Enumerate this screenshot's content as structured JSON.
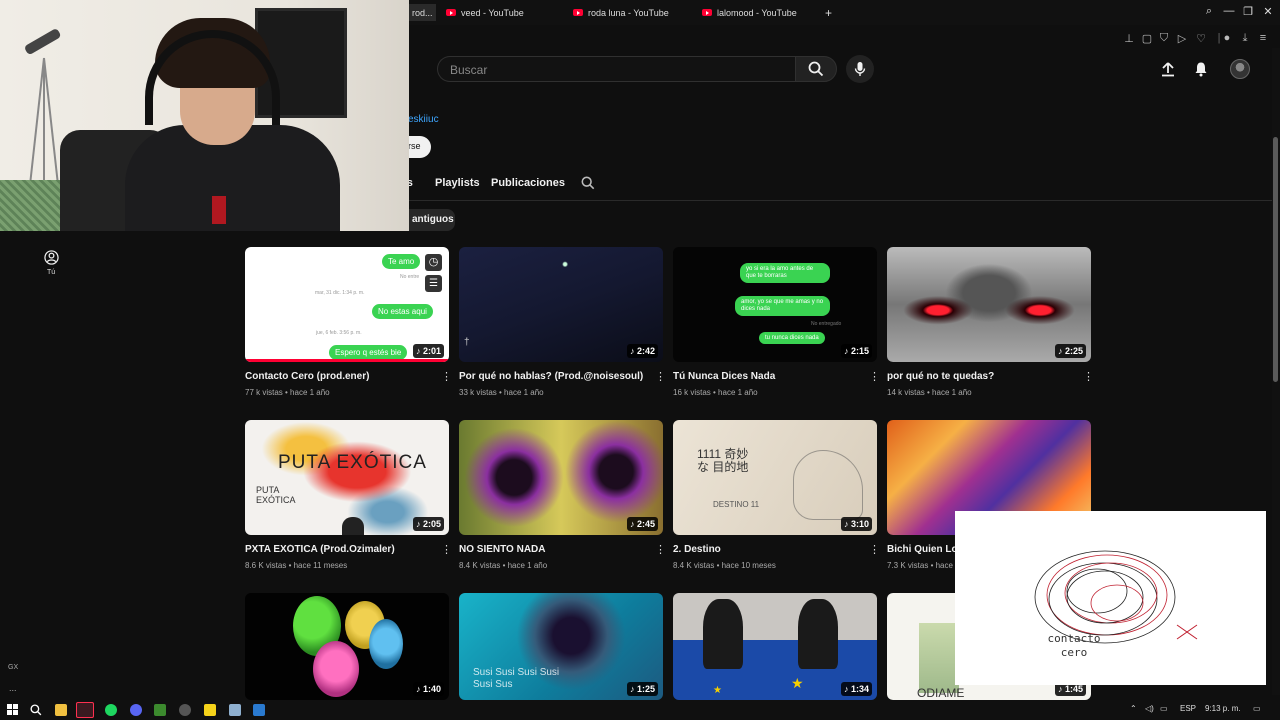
{
  "browser": {
    "tabs": [
      {
        "label": "rod..."
      },
      {
        "label": "veed - YouTube"
      },
      {
        "label": "roda luna - YouTube"
      },
      {
        "label": "lalomood - YouTube"
      }
    ],
    "new_tab_label": "+"
  },
  "masthead": {
    "search_placeholder": "Buscar"
  },
  "channel": {
    "handle": "eskiiuc",
    "subscribe_fragment": "rse",
    "tabs": [
      "os",
      "Playlists",
      "Publicaciones"
    ],
    "chip_label": "antiguos"
  },
  "guide": {
    "you_label": "Tú",
    "gx_label": "GX",
    "more_label": "..."
  },
  "videos": [
    {
      "title": "Contacto Cero (prod.ener)",
      "meta": "77 k vistas • hace 1 año",
      "duration": "2:01"
    },
    {
      "title": "Por qué no hablas? (Prod.@noisesoul)",
      "meta": "33 k vistas • hace 1 año",
      "duration": "2:42"
    },
    {
      "title": "Tú Nunca Dices Nada",
      "meta": "16 k vistas • hace 1 año",
      "duration": "2:15"
    },
    {
      "title": "por qué no te quedas?",
      "meta": "14 k vistas • hace 1 año",
      "duration": "2:25"
    },
    {
      "title": "PXTA EXÓTICA (Prod.Ozimaler)",
      "meta": "8.6 K vistas • hace 11 meses",
      "duration": "2:05"
    },
    {
      "title": "NO SIENTO NADA",
      "meta": "8.4 K vistas • hace 1 año",
      "duration": "2:45"
    },
    {
      "title": "2. Destino",
      "meta": "8.4 K vistas • hace 10 meses",
      "duration": "3:10"
    },
    {
      "title": "Bichi Quien Lo H",
      "meta": "7.3 K vistas • hace",
      "duration": ""
    },
    {
      "title": "",
      "meta": "",
      "duration": "1:40"
    },
    {
      "title": "",
      "meta": "",
      "duration": "1:25"
    },
    {
      "title": "",
      "meta": "",
      "duration": "1:34"
    },
    {
      "title": "",
      "meta": "",
      "duration": "1:45"
    }
  ],
  "thumb_text": {
    "chat1": {
      "bubble1": "Te amo",
      "stamp1": "No entre",
      "date1": "mar, 31 dic. 1:34 p. m.",
      "bubble2": "No estas aqui",
      "date2": "jue, 6 feb. 3:56 p. m.",
      "bubble3": "Espero q estés bie"
    },
    "chat3": {
      "bubble1": "yo si era la amo antes de que te borraras",
      "bubble2": "amor, yo se que me amas y no dices nada",
      "bubble3": "tu nunca dices nada",
      "stamp": "No entregado"
    },
    "puta": {
      "big": "PUTA EXÓTICA",
      "small": "PUTA EXÓTICA"
    },
    "destino": {
      "kanji": "1111 奇妙な 目的地",
      "sub": "DESTINO 11"
    },
    "sushi": "Susi Susi Susi Susi Susi Sus",
    "odiame": "ODIAME"
  },
  "mini_player": {
    "line1": "contacto",
    "line2": "cero"
  },
  "taskbar": {
    "lang": "ESP",
    "time": "9:13 p. m."
  },
  "colors": {
    "background": "#0f0f0f",
    "accent_link": "#3ea6ff",
    "youtube_red": "#ff0033",
    "chat_green": "#3ad352"
  }
}
